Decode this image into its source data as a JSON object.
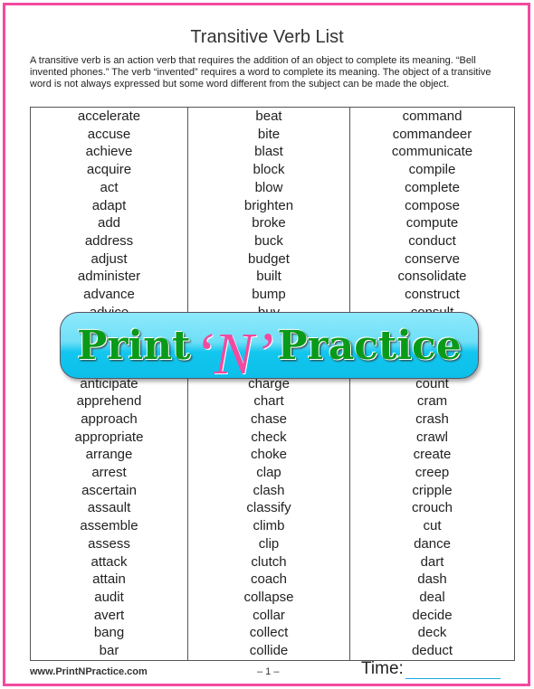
{
  "title": "Transitive Verb List",
  "intro": "A transitive verb is an action verb that requires the addition of an object to complete its meaning. “Bell invented phones.” The verb “invented” requires a word to complete its meaning. The object of a transitive word is not always expressed but some word different from the subject can be made the object.",
  "columns": [
    [
      "accelerate",
      "accuse",
      "achieve",
      "acquire",
      "act",
      "adapt",
      "add",
      "address",
      "adjust",
      "administer",
      "advance",
      "advice",
      "",
      "",
      "",
      "anticipate",
      "apprehend",
      "approach",
      "appropriate",
      "arrange",
      "arrest",
      "ascertain",
      "assault",
      "assemble",
      "assess",
      "attack",
      "attain",
      "audit",
      "avert",
      "bang",
      "bar"
    ],
    [
      "beat",
      "bite",
      "blast",
      "block",
      "blow",
      "brighten",
      "broke",
      "buck",
      "budget",
      "built",
      "bump",
      "buy",
      "",
      "",
      "",
      "charge",
      "chart",
      "chase",
      "check",
      "choke",
      "clap",
      "clash",
      "classify",
      "climb",
      "clip",
      "clutch",
      "coach",
      "collapse",
      "collar",
      "collect",
      "collide"
    ],
    [
      "command",
      "commandeer",
      "communicate",
      "compile",
      "complete",
      "compose",
      "compute",
      "conduct",
      "conserve",
      "consolidate",
      "construct",
      "consult",
      "",
      "",
      "",
      "count",
      "cram",
      "crash",
      "crawl",
      "create",
      "creep",
      "cripple",
      "crouch",
      "cut",
      "dance",
      "dart",
      "dash",
      "deal",
      "decide",
      "deck",
      "deduct"
    ]
  ],
  "banner": {
    "part1": "Print",
    "part2": "‘N’",
    "part3": "Practice"
  },
  "footer": {
    "url": "www.PrintNPractice.com",
    "page": "– 1 –",
    "time_label": "Time:"
  },
  "colors": {
    "border": "#f24aa0",
    "logo_green": "#0a9a1a",
    "logo_pink": "#f24aa0",
    "banner_cyan": "#13c6ef"
  }
}
